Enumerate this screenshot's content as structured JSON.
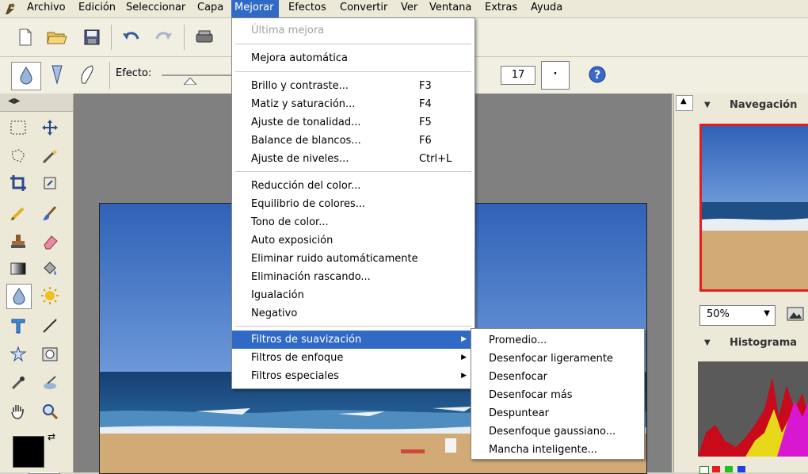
{
  "menubar": {
    "items": [
      "Archivo",
      "Edición",
      "Seleccionar",
      "Capa",
      "Mejorar",
      "Efectos",
      "Convertir",
      "Ver",
      "Ventana",
      "Extras",
      "Ayuda"
    ]
  },
  "options_bar": {
    "effect_label": "Efecto:",
    "size_value": "17",
    "shape_value": "·"
  },
  "mejorar_menu": {
    "items": [
      {
        "label": "Última mejora",
        "shortcut": "",
        "disabled": true
      },
      {
        "label": "Mejora automática",
        "shortcut": ""
      },
      {
        "label": "Brillo y contraste...",
        "shortcut": "F3"
      },
      {
        "label": "Matiz y saturación...",
        "shortcut": "F4"
      },
      {
        "label": "Ajuste de tonalidad...",
        "shortcut": "F5"
      },
      {
        "label": "Balance de blancos...",
        "shortcut": "F6"
      },
      {
        "label": "Ajuste de niveles...",
        "shortcut": "Ctrl+L"
      },
      {
        "label": "Reducción del color...",
        "shortcut": ""
      },
      {
        "label": "Equilibrio de colores...",
        "shortcut": ""
      },
      {
        "label": "Tono de color...",
        "shortcut": ""
      },
      {
        "label": "Auto exposición",
        "shortcut": ""
      },
      {
        "label": "Eliminar ruido automáticamente",
        "shortcut": ""
      },
      {
        "label": "Eliminación rascando...",
        "shortcut": ""
      },
      {
        "label": "Igualación",
        "shortcut": ""
      },
      {
        "label": "Negativo",
        "shortcut": ""
      },
      {
        "label": "Filtros de suavización",
        "shortcut": "",
        "submenu": true,
        "highlighted": true
      },
      {
        "label": "Filtros de enfoque",
        "shortcut": "",
        "submenu": true
      },
      {
        "label": "Filtros especiales",
        "shortcut": "",
        "submenu": true
      }
    ]
  },
  "submenu": {
    "items": [
      "Promedio...",
      "Desenfocar ligeramente",
      "Desenfocar",
      "Desenfocar más",
      "Despuntear",
      "Desenfoque gaussiano...",
      "Mancha inteligente..."
    ]
  },
  "right_panel": {
    "navigation_title": "Navegación",
    "zoom_value": "50%",
    "histogram_title": "Histograma"
  },
  "colors": {
    "menu_highlight": "#316ac5",
    "nav_border": "#e02020",
    "sky": "#3f73c4",
    "sea": "#1e4f86",
    "sand": "#d2aa76"
  },
  "icons": {
    "toolbar": [
      "new-document-icon",
      "open-folder-icon",
      "save-disk-icon",
      "undo-icon",
      "redo-icon",
      "scanner-icon"
    ],
    "tools": [
      "marquee-icon",
      "move-icon",
      "lasso-icon",
      "magic-wand-icon",
      "crop-icon",
      "transform-icon",
      "pencil-icon",
      "brush-icon",
      "clone-stamp-icon",
      "eraser-icon",
      "gradient-icon",
      "fill-bucket-icon",
      "blur-drop-icon",
      "sun-dodge-icon",
      "text-icon",
      "line-icon",
      "shape-icon",
      "rectangle-icon",
      "eyedropper-icon",
      "smudge-icon",
      "hand-icon",
      "zoom-icon"
    ]
  }
}
